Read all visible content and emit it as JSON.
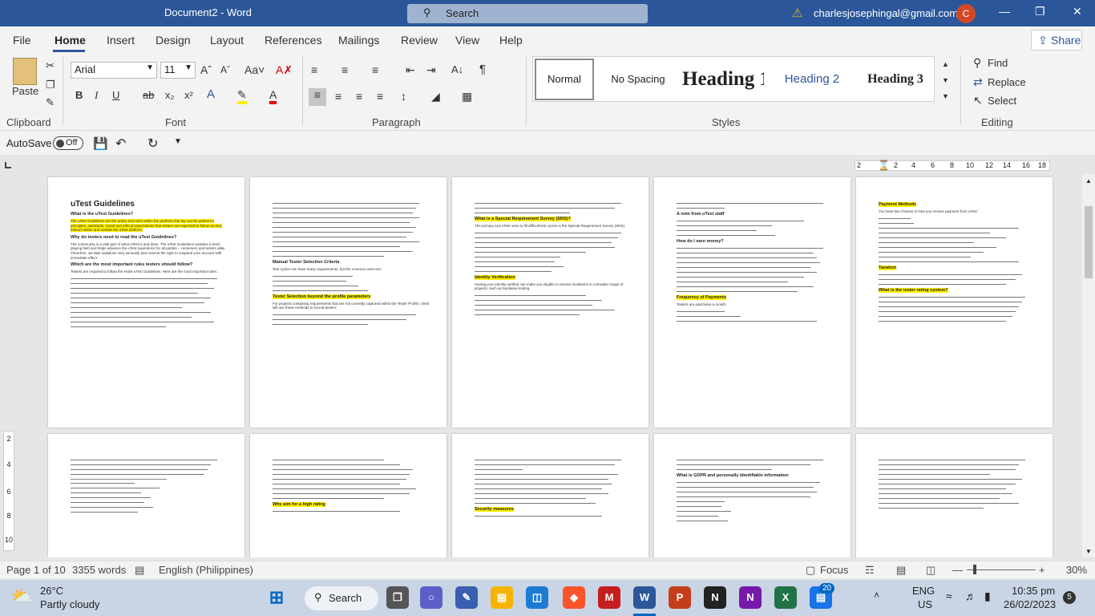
{
  "titlebar": {
    "doc_title": "Document2  -  Word",
    "search_placeholder": "Search",
    "account_email": "charlesjosephingal@gmail.com",
    "avatar_initial": "C"
  },
  "tabs": [
    "File",
    "Home",
    "Insert",
    "Design",
    "Layout",
    "References",
    "Mailings",
    "Review",
    "View",
    "Help"
  ],
  "share_label": "Share",
  "ribbon": {
    "clipboard": {
      "paste_label": "Paste",
      "group_label": "Clipboard"
    },
    "font": {
      "name": "Arial",
      "size": "11",
      "group_label": "Font"
    },
    "paragraph": {
      "group_label": "Paragraph"
    },
    "styles": {
      "items": [
        "Normal",
        "No Spacing",
        "Heading 1",
        "Heading 2",
        "Heading 3"
      ],
      "group_label": "Styles"
    },
    "editing": {
      "find": "Find",
      "replace": "Replace",
      "select": "Select",
      "group_label": "Editing"
    }
  },
  "qat": {
    "autosave_label": "AutoSave",
    "autosave_state": "Off"
  },
  "ruler_ticks": [
    "2",
    "2",
    "4",
    "6",
    "8",
    "10",
    "12",
    "14",
    "16",
    "18"
  ],
  "vruler": [
    "2",
    "4",
    "6",
    "8",
    "10"
  ],
  "doc": {
    "p1_title": "uTest Guidelines",
    "p1_h1": "What is the uTest Guidelines?",
    "p1_t1": "The uTest Guidelines are the policy and rules within the platform that lay out the platform's principles, standards, moral and ethical expectations that testers are expected to follow as they interact within and outside the uTest platform.",
    "p1_h2": "Why do testers need to read the uTest Guidelines?",
    "p1_t2": "The community is a vital part of what uTest is and does. The uTest Guidelines sustains a level playing field and helps advance the uTest experience for all parties – customers and testers alike. Therefore, we take violations very seriously and reserve the right to suspend your account with immediate effect.",
    "p1_h3": "Which are the most important rules testers should follow?",
    "p1_t3": "Testers are required to follow the entire uTest Guidelines. Here are the most important rules:",
    "p2_h1": "Manual Tester Selection Criteria",
    "p2_t1": "Test cycles can have many requirements, but the common ones are:",
    "p2_h2": "Tester Selection beyond the profile parameters",
    "p2_t2": "For projects containing requirements that are not currently captured within the Tester Profile, uTest will use these methods to recruit testers:",
    "p3_h1": "What is a Special Requirement Survey (SRS)?",
    "p3_t1": "The primary tool uTest uses to fill difficult test cycles is the Special Requirement Survey (SRS).",
    "p3_h2": "Identity Verification",
    "p3_t2": "Having your identity verified can make you eligible to receive invitations to a broader range of projects, such as hardware testing.",
    "p4_h1": "A note from uTest staff",
    "p4_h2": "How do I earn money?",
    "p4_h3": "Frequency of Payments",
    "p4_t3": "Testers are paid twice a month:",
    "p5_h1": "Payment Methods",
    "p5_t1": "You have two choices in how you receive payment from uTest:",
    "p5_h2": "Taxation",
    "p5_h3": "What is the tester rating system?",
    "p7_h1": "Why aim for a high rating",
    "p8_h1": "Security measures",
    "p9_h1": "What is GDPR and personally identifiable information"
  },
  "status": {
    "page": "Page 1 of 10",
    "words": "3355 words",
    "language": "English (Philippines)",
    "focus": "Focus",
    "zoom": "30%"
  },
  "taskbar": {
    "temp": "26°C",
    "weather": "Partly cloudy",
    "search_label": "Search",
    "lang": "ENG",
    "region": "US",
    "time": "10:35 pm",
    "date": "26/02/2023",
    "badge": "20",
    "notif": "5"
  }
}
